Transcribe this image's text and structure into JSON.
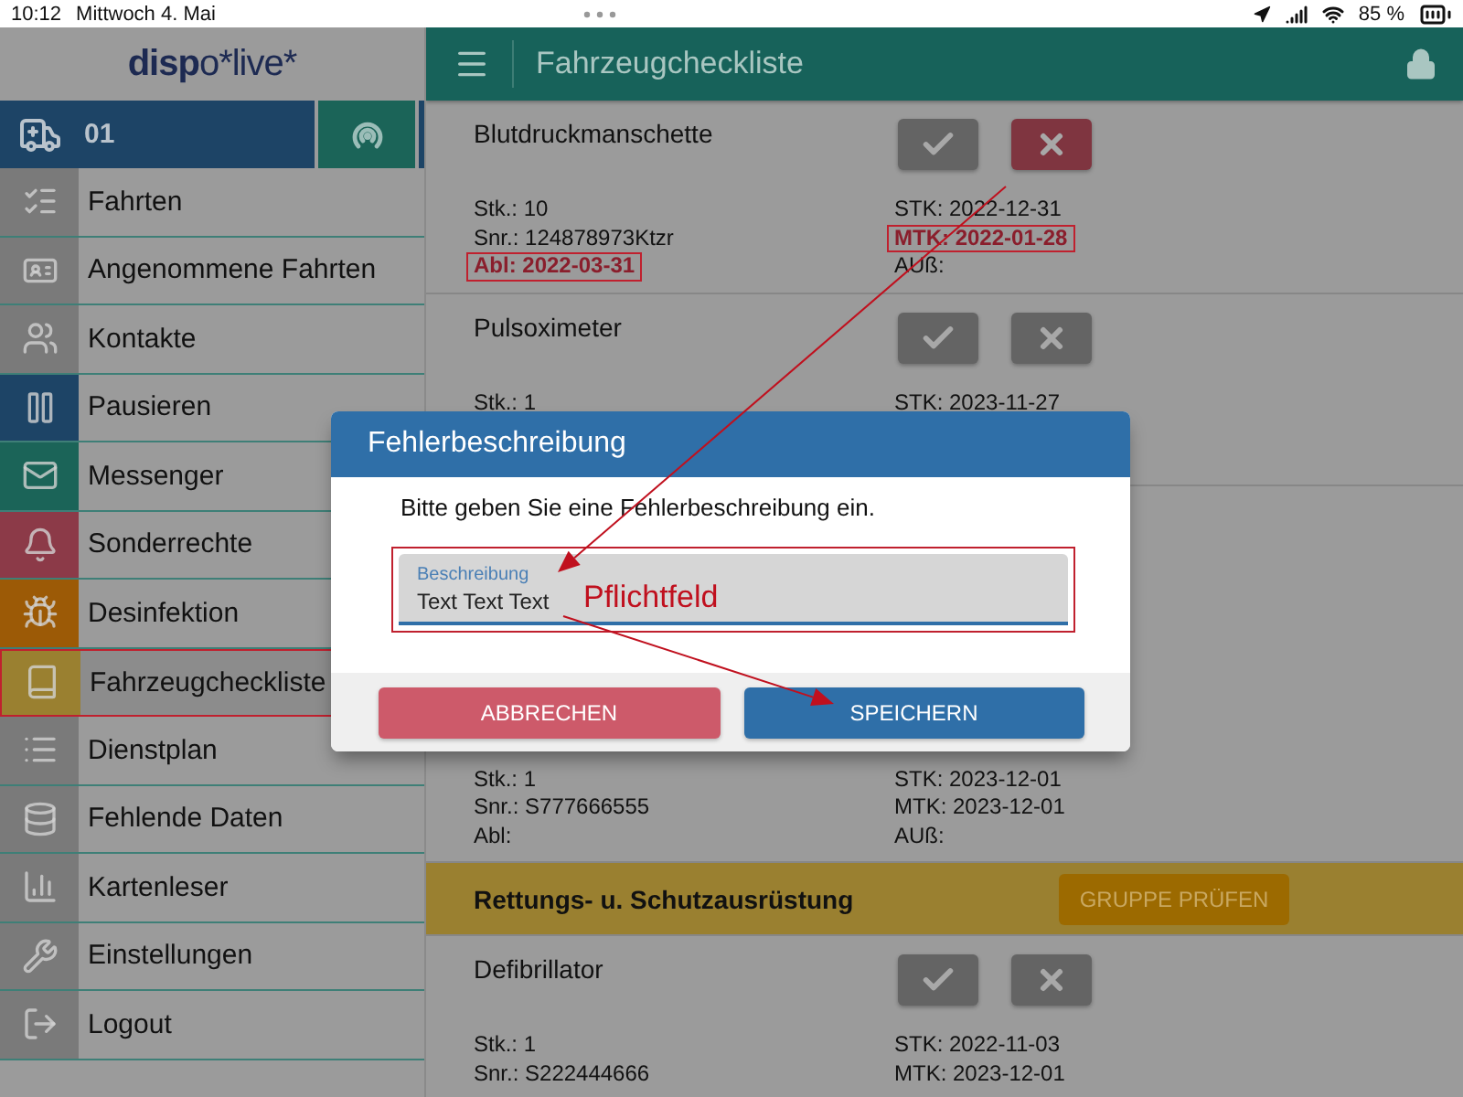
{
  "status_bar": {
    "time": "10:12",
    "date": "Mittwoch 4. Mai",
    "battery": "85 %"
  },
  "sidebar": {
    "logo": "**disp**o*live*",
    "vehicle": "01",
    "items": [
      {
        "label": "Fahrten",
        "color": "#7a7a7a",
        "selected": false
      },
      {
        "label": "Angenommene Fahrten",
        "color": "#7a7a7a",
        "selected": false
      },
      {
        "label": "Kontakte",
        "color": "#7a7a7a",
        "selected": false
      },
      {
        "label": "Pausieren",
        "color": "#1d4466",
        "selected": false
      },
      {
        "label": "Messenger",
        "color": "#1b6458",
        "selected": false
      },
      {
        "label": "Sonderrechte",
        "color": "#8c3a48",
        "selected": false
      },
      {
        "label": "Desinfektion",
        "color": "#9c5a06",
        "selected": false
      },
      {
        "label": "Fahrzeugcheckliste",
        "color": "#9a8030",
        "selected": true
      },
      {
        "label": "Dienstplan",
        "color": "#7a7a7a",
        "selected": false
      },
      {
        "label": "Fehlende Daten",
        "color": "#7a7a7a",
        "selected": false
      },
      {
        "label": "Kartenleser",
        "color": "#7a7a7a",
        "selected": false
      },
      {
        "label": "Einstellungen",
        "color": "#7a7a7a",
        "selected": false
      },
      {
        "label": "Logout",
        "color": "#7a7a7a",
        "selected": false
      }
    ]
  },
  "header": {
    "title": "Fahrzeugcheckliste"
  },
  "checklist": {
    "rows": [
      {
        "kind": "item",
        "name": "Blutdruckmanschette",
        "failed": true,
        "left": [
          {
            "text": "Stk.: 10",
            "flagged": false
          },
          {
            "text": "Snr.: 124878973Ktzr",
            "flagged": false
          },
          {
            "text": "Abl: 2022-03-31",
            "flagged": true
          }
        ],
        "right": [
          {
            "text": "STK: 2022-12-31",
            "flagged": false
          },
          {
            "text": "MTK: 2022-01-28",
            "flagged": true
          },
          {
            "text": "AUß:",
            "flagged": false
          }
        ]
      },
      {
        "kind": "item",
        "name": "Pulsoximeter",
        "failed": false,
        "left": [
          {
            "text": "Stk.: 1",
            "flagged": false
          }
        ],
        "right": [
          {
            "text": "STK: 2023-11-27",
            "flagged": false
          }
        ]
      },
      {
        "kind": "item",
        "left": [
          {
            "text": "Stk.: 1",
            "flagged": false
          },
          {
            "text": "Snr.: S777666555",
            "flagged": false
          },
          {
            "text": "Abl:",
            "flagged": false
          }
        ],
        "right": [
          {
            "text": "STK: 2023-12-01",
            "flagged": false
          },
          {
            "text": "MTK: 2023-12-01",
            "flagged": false
          },
          {
            "text": "AUß:",
            "flagged": false
          }
        ]
      },
      {
        "kind": "group",
        "title": "Rettungs- u. Schutzausrüstung",
        "button": "GRUPPE PRÜFEN"
      },
      {
        "kind": "item",
        "name": "Defibrillator",
        "failed": false,
        "left": [
          {
            "text": "Stk.: 1",
            "flagged": false
          },
          {
            "text": "Snr.: S222444666",
            "flagged": false
          }
        ],
        "right": [
          {
            "text": "STK: 2022-11-03",
            "flagged": false
          },
          {
            "text": "MTK: 2023-12-01",
            "flagged": false
          }
        ]
      }
    ]
  },
  "dialog": {
    "title": "Fehlerbeschreibung",
    "message": "Bitte geben Sie eine Fehlerbeschreibung ein.",
    "field": {
      "label": "Beschreibung",
      "value": "Text Text Text",
      "highlighted": true
    },
    "buttons": [
      {
        "label": "ABBRECHEN",
        "kind": "cancel"
      },
      {
        "label": "SPEICHERN",
        "kind": "save"
      }
    ]
  },
  "annotations": {
    "label": "Pflichtfeld"
  }
}
